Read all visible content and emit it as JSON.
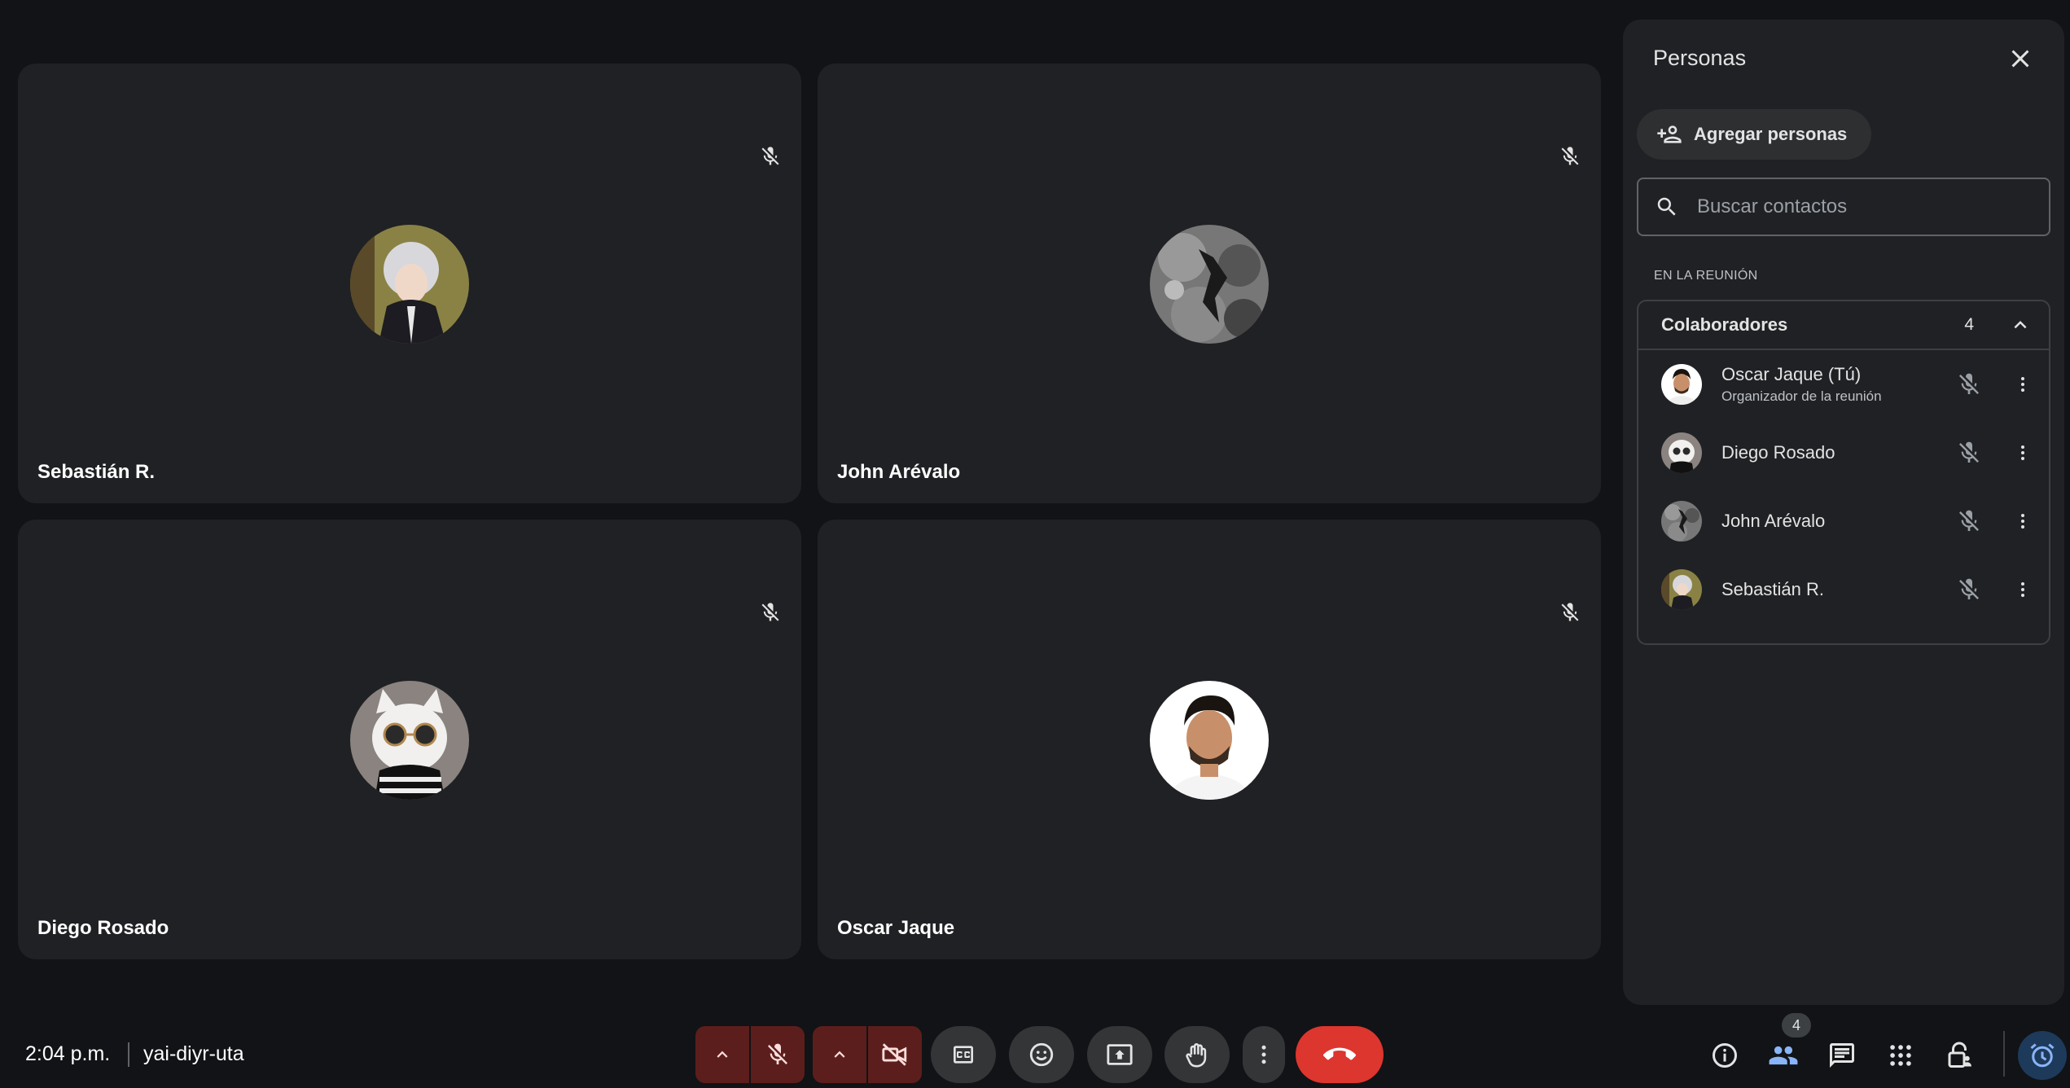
{
  "tiles": [
    {
      "name": "Sebastián R.",
      "avatar": "anime-avatar"
    },
    {
      "name": "John Arévalo",
      "avatar": "grayscale-avatar"
    },
    {
      "name": "Diego Rosado",
      "avatar": "cat-avatar"
    },
    {
      "name": "Oscar Jaque",
      "avatar": "man-photo-avatar"
    }
  ],
  "panel": {
    "title": "Personas",
    "add_label": "Agregar personas",
    "search_placeholder": "Buscar contactos",
    "section_label": "EN LA REUNIÓN",
    "group": {
      "title": "Colaboradores",
      "count": "4",
      "people": [
        {
          "name": "Oscar Jaque (Tú)",
          "role": "Organizador de la reunión"
        },
        {
          "name": "Diego Rosado",
          "role": ""
        },
        {
          "name": "John Arévalo",
          "role": ""
        },
        {
          "name": "Sebastián R.",
          "role": ""
        }
      ]
    }
  },
  "bottom": {
    "time": "2:04 p.m.",
    "meeting_code": "yai-diyr-uta",
    "people_badge": "4"
  },
  "colors": {
    "background": "#111316",
    "tile": "#202124",
    "hangup": "#dc362e",
    "muted_control": "#5c1e1c",
    "accent": "#8ab4f8"
  }
}
